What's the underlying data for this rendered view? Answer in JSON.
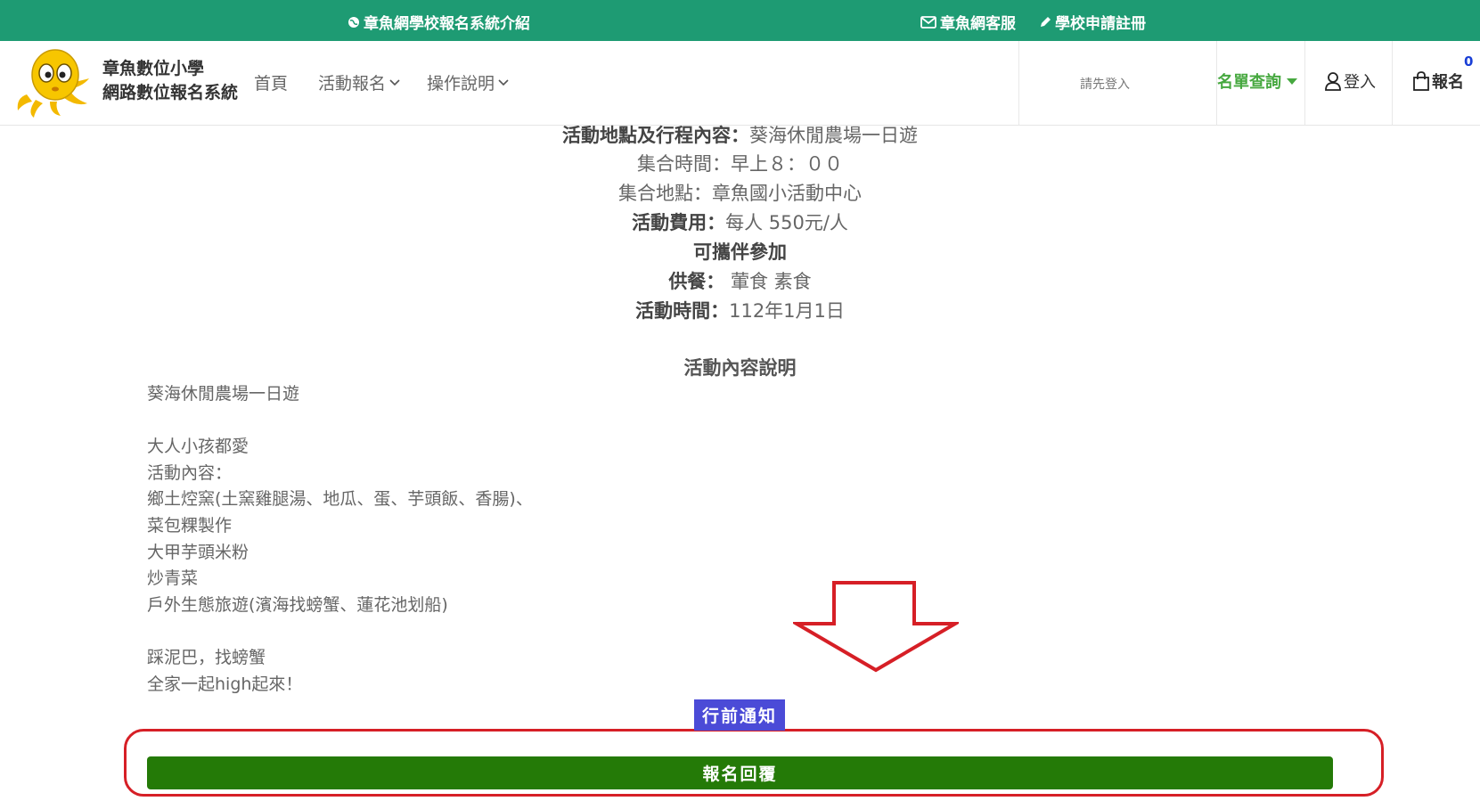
{
  "topbar": {
    "intro_link": "章魚網學校報名系統介紹",
    "service_link": "章魚網客服",
    "register_link": "學校申請註冊"
  },
  "header": {
    "brand_line1": "章魚數位小學",
    "brand_line2": "網路數位報名系統",
    "nav_home": "首頁",
    "nav_activity": "活動報名",
    "nav_guide": "操作說明",
    "login_hint": "請先登入",
    "name_list": "名單查詢",
    "login": "登入",
    "cart_label": "報名",
    "cart_count": "0"
  },
  "info": {
    "location_label": "活動地點及行程內容：",
    "location_value": "葵海休閒農場一日遊",
    "gather_time": "集合時間：早上８：００",
    "gather_place": "集合地點：章魚國小活動中心",
    "fee_label": "活動費用：",
    "fee_value": "每人 550元/人",
    "companion": "可攜伴參加",
    "meal_label": "供餐：",
    "meal_value": " 葷食 素食",
    "date_label": "活動時間：",
    "date_value": "112年1月1日"
  },
  "description": {
    "title": "活動內容說明",
    "lines": [
      "葵海休閒農場一日遊",
      "",
      "大人小孩都愛",
      "活動內容：",
      "鄉土焢窯(土窯雞腿湯、地瓜、蛋、芋頭飯、香腸)、",
      "菜包粿製作",
      "大甲芋頭米粉",
      "炒青菜",
      "戶外生態旅遊(濱海找螃蟹、蓮花池划船)",
      "",
      "踩泥巴，找螃蟹",
      "全家一起high起來！"
    ]
  },
  "actions": {
    "notice_label": "行前通知",
    "reply_label": "報名回覆"
  },
  "colors": {
    "topbar": "#1e9b73",
    "name_list": "#46a83f",
    "notice_bg": "#4b4bd7",
    "reply_bg": "#247a07",
    "highlight": "#d61f26"
  }
}
